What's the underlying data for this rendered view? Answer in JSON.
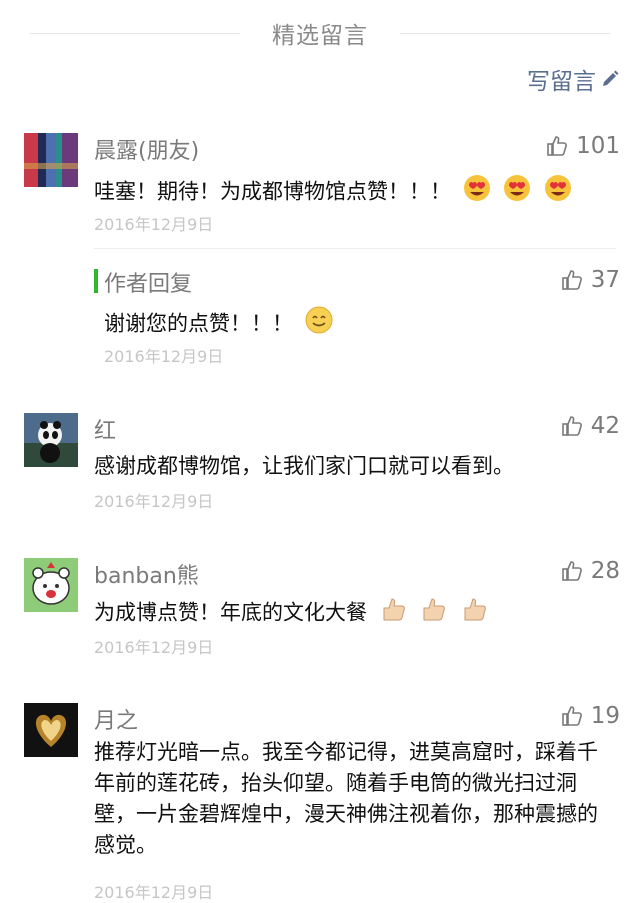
{
  "header": {
    "title": "精选留言",
    "write_label": "写留言"
  },
  "comments": [
    {
      "name": "晨露(朋友)",
      "likes": "101",
      "text": "哇塞！期待！为成都博物馆点赞！！！",
      "date": "2016年12月9日",
      "reply": {
        "label": "作者回复",
        "likes": "37",
        "text": "谢谢您的点赞！！！",
        "date": "2016年12月9日"
      }
    },
    {
      "name": "红",
      "likes": "42",
      "text": "感谢成都博物馆，让我们家门口就可以看到。",
      "date": "2016年12月9日"
    },
    {
      "name": "banban熊",
      "likes": "28",
      "text": "为成博点赞！年底的文化大餐",
      "date": "2016年12月9日"
    },
    {
      "name": "月之",
      "likes": "19",
      "text": "推荐灯光暗一点。我至今都记得，进莫高窟时，踩着千年前的莲花砖，抬头仰望。随着手电筒的微光扫过洞壁，一片金碧辉煌中，漫天神佛注视着你，那种震撼的感觉。",
      "date": "2016年12月9日"
    }
  ],
  "icons": {
    "like": "thumbs-up-icon",
    "write": "pencil-icon",
    "emoji_heart_eyes": "heart-eyes-emoji",
    "emoji_smile": "smile-emoji",
    "emoji_thumbs": "thumbs-up-emoji"
  },
  "colors": {
    "accent_link": "#5a6f8f",
    "reply_bar": "#2fb82f",
    "muted": "#7a7a7a",
    "date": "#c6c6c6"
  }
}
